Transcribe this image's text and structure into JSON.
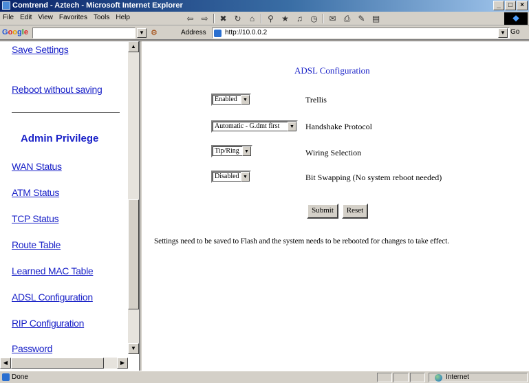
{
  "window": {
    "title": "Comtrend - Aztech - Microsoft Internet Explorer",
    "controls": [
      "_",
      "□",
      "×"
    ]
  },
  "menubar": {
    "items": [
      "File",
      "Edit",
      "View",
      "Favorites",
      "Tools",
      "Help"
    ]
  },
  "google_bar": {
    "logo": [
      "G",
      "o",
      "o",
      "g",
      "l",
      "e"
    ],
    "search_value": ""
  },
  "address_bar": {
    "label": "Address",
    "url": "http://10.0.0.2",
    "go_label": "Go"
  },
  "sidebar": {
    "links_top": [
      "Save Settings",
      "Reboot without saving"
    ],
    "heading": "Admin Privilege",
    "links": [
      "WAN Status",
      "ATM Status",
      "TCP Status",
      "Route Table",
      "Learned MAC Table",
      "ADSL Configuration",
      "RIP Configuration",
      "Password"
    ]
  },
  "main": {
    "title": "ADSL Configuration",
    "fields": [
      {
        "value": "Enabled",
        "label": "Trellis"
      },
      {
        "value": "Automatic - G.dmt first",
        "label": "Handshake Protocol"
      },
      {
        "value": "Tip/Ring",
        "label": "Wiring Selection"
      },
      {
        "value": "Disabled",
        "label": "Bit Swapping (No system reboot needed)"
      }
    ],
    "submit_label": "Submit",
    "reset_label": "Reset",
    "notice": "Settings need to be saved to Flash and the system needs to be rebooted for changes to take effect."
  },
  "statusbar": {
    "text": "Done",
    "zone": "Internet"
  }
}
